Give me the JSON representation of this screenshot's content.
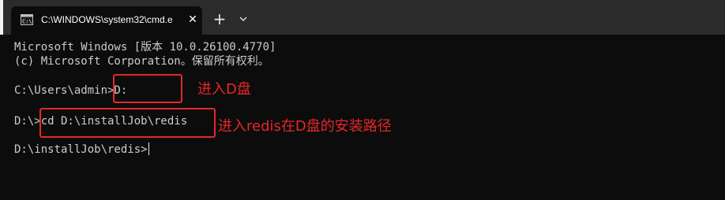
{
  "tab": {
    "title": "C:\\WINDOWS\\system32\\cmd.e",
    "icon": "cmd-icon",
    "close": "✕"
  },
  "tabbar": {
    "new_tab": "+",
    "dropdown_icon": "chevron-down-icon"
  },
  "console": {
    "lines": [
      "Microsoft Windows [版本 10.0.26100.4770]",
      "(c) Microsoft Corporation。保留所有权利。",
      "C:\\Users\\admin>D:",
      "D:\\>cd D:\\installJob\\redis",
      "D:\\installJob\\redis>"
    ]
  },
  "annotations": [
    {
      "text": "进入D盘"
    },
    {
      "text": "进入redis在D盘的安装路径"
    }
  ],
  "colors": {
    "console_bg": "#0c0c0c",
    "console_text": "#cccccc",
    "titlebar_bg": "#2b2b2b",
    "annotation": "#e8262a"
  }
}
